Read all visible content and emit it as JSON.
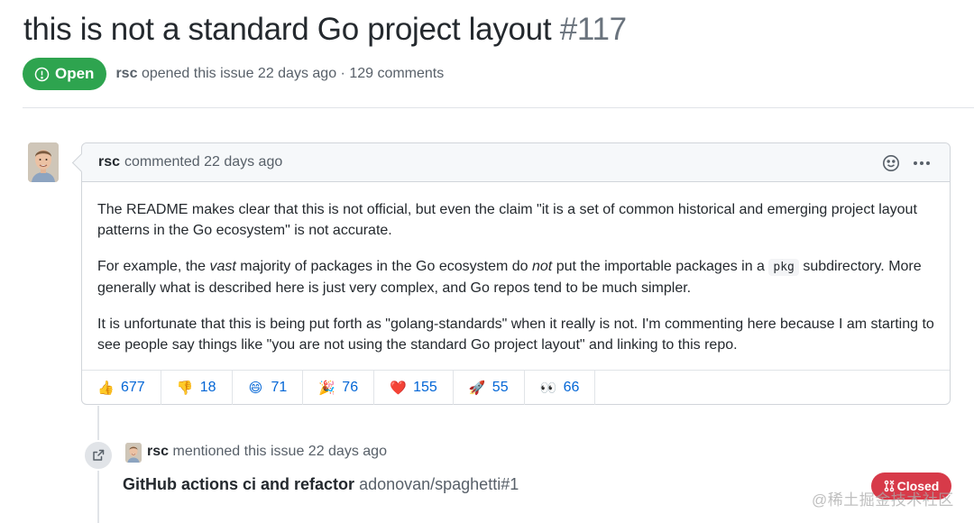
{
  "issue": {
    "title": "this is not a standard Go project layout",
    "number": "#117",
    "state": "Open",
    "state_icon": "issue-opened-icon",
    "author": "rsc",
    "meta": "opened this issue 22 days ago · 129 comments"
  },
  "comment": {
    "author": "rsc",
    "header_text": "commented 22 days ago",
    "paragraphs": {
      "p1": "The README makes clear that this is not official, but even the claim \"it is a set of common historical and emerging project layout patterns in the Go ecosystem\" is not accurate.",
      "p2": {
        "a": "For example, the ",
        "b": "vast",
        "c": " majority of packages in the Go ecosystem do ",
        "d": "not",
        "e": " put the importable packages in a ",
        "code": "pkg",
        "f": " subdirectory. More generally what is described here is just very complex, and Go repos tend to be much simpler."
      },
      "p3": "It is unfortunate that this is being put forth as \"golang-standards\" when it really is not. I'm commenting here because I am starting to see people say things like \"you are not using the standard Go project layout\" and linking to this repo."
    },
    "reactions": [
      {
        "emoji": "👍",
        "icon": "thumbs-up",
        "count": "677"
      },
      {
        "emoji": "👎",
        "icon": "thumbs-down",
        "count": "18"
      },
      {
        "emoji": "😄",
        "icon": "laugh",
        "count": "71"
      },
      {
        "emoji": "🎉",
        "icon": "hooray",
        "count": "76"
      },
      {
        "emoji": "❤️",
        "icon": "heart",
        "count": "155"
      },
      {
        "emoji": "🚀",
        "icon": "rocket",
        "count": "55"
      },
      {
        "emoji": "👀",
        "icon": "eyes",
        "count": "66"
      }
    ]
  },
  "mention": {
    "author": "rsc",
    "text": "mentioned this issue 22 days ago",
    "ref_title": "GitHub actions ci and refactor",
    "ref_repo": "adonovan/spaghetti#1",
    "ref_state": "Closed"
  },
  "watermark": "@稀土掘金技术社区",
  "colors": {
    "open_green": "#2ea44f",
    "closed_red": "#d73a49",
    "link_blue": "#0366d6"
  }
}
